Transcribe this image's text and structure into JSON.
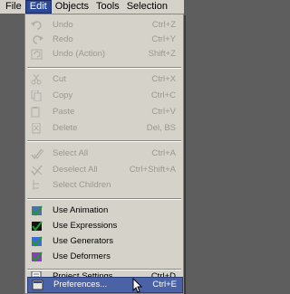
{
  "menubar": {
    "items": [
      "File",
      "Edit",
      "Objects",
      "Tools",
      "Selection"
    ],
    "active": "Edit"
  },
  "menu": {
    "items": [
      {
        "label": "Undo",
        "shortcut": "Ctrl+Z",
        "enabled": false,
        "icon": "undo-icon"
      },
      {
        "label": "Redo",
        "shortcut": "Ctrl+Y",
        "enabled": false,
        "icon": "redo-icon"
      },
      {
        "label": "Undo (Action)",
        "shortcut": "Shift+Z",
        "enabled": false,
        "icon": "undo-action-icon"
      },
      {
        "label": "Cut",
        "shortcut": "Ctrl+X",
        "enabled": false,
        "icon": "scissors-icon"
      },
      {
        "label": "Copy",
        "shortcut": "Ctrl+C",
        "enabled": false,
        "icon": "copy-icon"
      },
      {
        "label": "Paste",
        "shortcut": "Ctrl+V",
        "enabled": false,
        "icon": "paste-icon"
      },
      {
        "label": "Delete",
        "shortcut": "Del, BS",
        "enabled": false,
        "icon": "delete-icon"
      },
      {
        "label": "Select All",
        "shortcut": "Ctrl+A",
        "enabled": false,
        "icon": "select-all-icon"
      },
      {
        "label": "Deselect All",
        "shortcut": "Ctrl+Shift+A",
        "enabled": false,
        "icon": "deselect-all-icon"
      },
      {
        "label": "Select Children",
        "shortcut": "",
        "enabled": false,
        "icon": "select-children-icon"
      },
      {
        "label": "Use Animation",
        "shortcut": "",
        "enabled": true,
        "icon": "animation-check-icon"
      },
      {
        "label": "Use Expressions",
        "shortcut": "",
        "enabled": true,
        "icon": "expressions-check-icon"
      },
      {
        "label": "Use Generators",
        "shortcut": "",
        "enabled": true,
        "icon": "generators-check-icon"
      },
      {
        "label": "Use Deformers",
        "shortcut": "",
        "enabled": true,
        "icon": "deformers-check-icon"
      },
      {
        "label": "Project Settings...",
        "shortcut": "Ctrl+D",
        "enabled": true,
        "icon": "project-settings-icon"
      },
      {
        "label": "Preferences...",
        "shortcut": "Ctrl+E",
        "enabled": true,
        "highlighted": true,
        "icon": "preferences-icon"
      }
    ]
  },
  "colors": {
    "menu_bg": "#d4d2c9",
    "highlight": "#4b63a6",
    "disabled_text": "#9a988f",
    "active_menubar": "#2c4a9b"
  }
}
